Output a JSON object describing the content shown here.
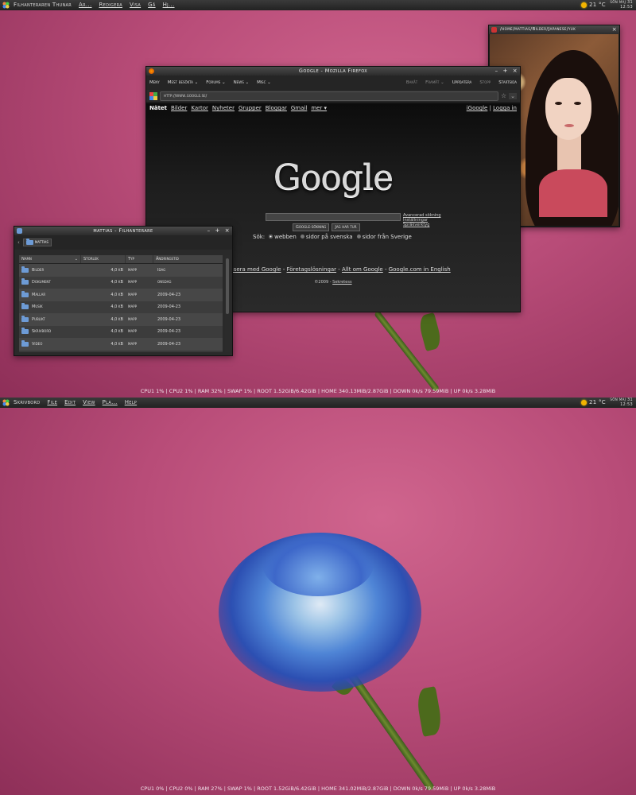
{
  "top_panel_1": {
    "menu": [
      "Filhanteraren Thunar",
      "Ar...",
      "Redigera",
      "Visa",
      "Gå",
      "Hj..."
    ],
    "weather": "21 °C",
    "clock_line1": "sön maj 31",
    "clock_line2": "12:53"
  },
  "top_panel_2": {
    "menu": [
      "Skrivbord",
      "File",
      "Edit",
      "View",
      "Pla...",
      "Help"
    ],
    "weather": "21 °C",
    "clock_line1": "sön maj 31",
    "clock_line2": "12:53"
  },
  "status_1": "CPU1 1% | CPU2 1% | RAM 32% | SWAP 1% | ROOT 1.52GiB/6.42GiB | HOME 340.13MiB/2.87GiB | DOWN 0k/s 79.59MiB | UP 0k/s 3.28MiB",
  "status_2": "CPU1 0% | CPU2 0% | RAM 27% | SWAP 1% | ROOT 1.52GiB/6.42GiB | HOME 341.02MiB/2.87GiB | DOWN 0k/s 79.59MiB | UP 0k/s 3.28MiB",
  "firefox": {
    "title": "Google - Mozilla Firefox",
    "menu": [
      "Meny",
      "Mest besökta",
      "Forums",
      "News",
      "Misc"
    ],
    "nav": [
      "Bakåt",
      "Framåt",
      "Uppdatera",
      "Stopp",
      "Startsida"
    ],
    "url": "http://www.google.se/",
    "google": {
      "nav": [
        "Nätet",
        "Bilder",
        "Kartor",
        "Nyheter",
        "Grupper",
        "Bloggar",
        "Gmail",
        "mer ▾"
      ],
      "right": [
        "iGoogle",
        "Logga in"
      ],
      "logo": "Google",
      "search_button": "Google-sökning",
      "lucky_button": "Jag har tur",
      "links": [
        "Avancerad sökning",
        "Inställningar",
        "Språkverktyg"
      ],
      "search_label": "Sök:",
      "options": [
        "webben",
        "sidor på svenska",
        "sidor från Sverige"
      ],
      "footer": [
        "Annonsera med Google",
        "Företagslösningar",
        "Allt om Google",
        "Google.com in English"
      ],
      "copyright": "©2009 -",
      "privacy": "Sekretess"
    }
  },
  "filemanager": {
    "title": "mattias - Filhanterare",
    "path": "mattias",
    "columns": [
      "Namn",
      "Storlek",
      "Typ",
      "Ändringstid"
    ],
    "rows": [
      {
        "name": "Bilder",
        "size": "4,0 kB",
        "type": "mapp",
        "date": "Idag"
      },
      {
        "name": "Dokument",
        "size": "4,0 kB",
        "type": "mapp",
        "date": "onsdag"
      },
      {
        "name": "Mallar",
        "size": "4,0 kB",
        "type": "mapp",
        "date": "2009-04-23"
      },
      {
        "name": "Musik",
        "size": "4,0 kB",
        "type": "mapp",
        "date": "2009-04-23"
      },
      {
        "name": "Publikt",
        "size": "4,0 kB",
        "type": "mapp",
        "date": "2009-04-23"
      },
      {
        "name": "Skrivbord",
        "size": "4,0 kB",
        "type": "mapp",
        "date": "2009-04-23"
      },
      {
        "name": "Video",
        "size": "4,0 kB",
        "type": "mapp",
        "date": "2009-04-23"
      }
    ]
  },
  "imageviewer": {
    "title": "/home/mattias/Bilder/Japanese/yuk"
  },
  "colors": {
    "wallpaper": "#b84c78",
    "panel": "#2a2a2a",
    "flower": "#3f6fd0",
    "folder": "#6d9bd6"
  }
}
